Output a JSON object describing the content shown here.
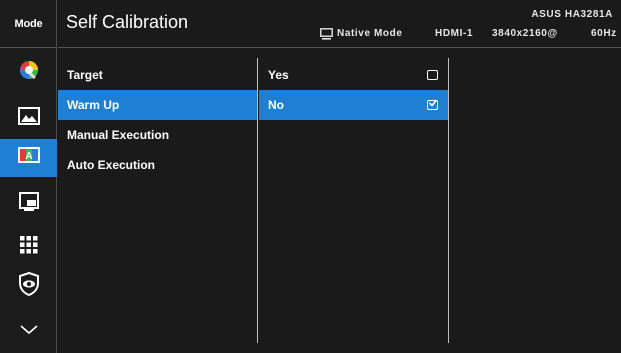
{
  "nav": {
    "mode_label": "Mode",
    "items": [
      {
        "icon": "color-icon"
      },
      {
        "icon": "image-icon"
      },
      {
        "icon": "color-adjust-icon",
        "active": true
      },
      {
        "icon": "input-select-icon"
      },
      {
        "icon": "menu-grid-icon"
      },
      {
        "icon": "eye-shield-icon"
      },
      {
        "icon": "chevron-down-icon"
      }
    ]
  },
  "header": {
    "title": "Self Calibration",
    "mode": "Native Mode",
    "input": "HDMI-1",
    "resolution": "3840x2160@",
    "refresh": "60Hz",
    "model": "ASUS HA3281A"
  },
  "menu": {
    "items": [
      {
        "label": "Target"
      },
      {
        "label": "Warm Up",
        "selected": true
      },
      {
        "label": "Manual Execution"
      },
      {
        "label": "Auto Execution"
      }
    ]
  },
  "options": {
    "items": [
      {
        "label": "Yes",
        "checked": false
      },
      {
        "label": "No",
        "checked": true,
        "selected": true
      }
    ]
  },
  "colors": {
    "accent": "#1f7fd3",
    "background": "#1a1a1a",
    "text": "#ffffff"
  }
}
